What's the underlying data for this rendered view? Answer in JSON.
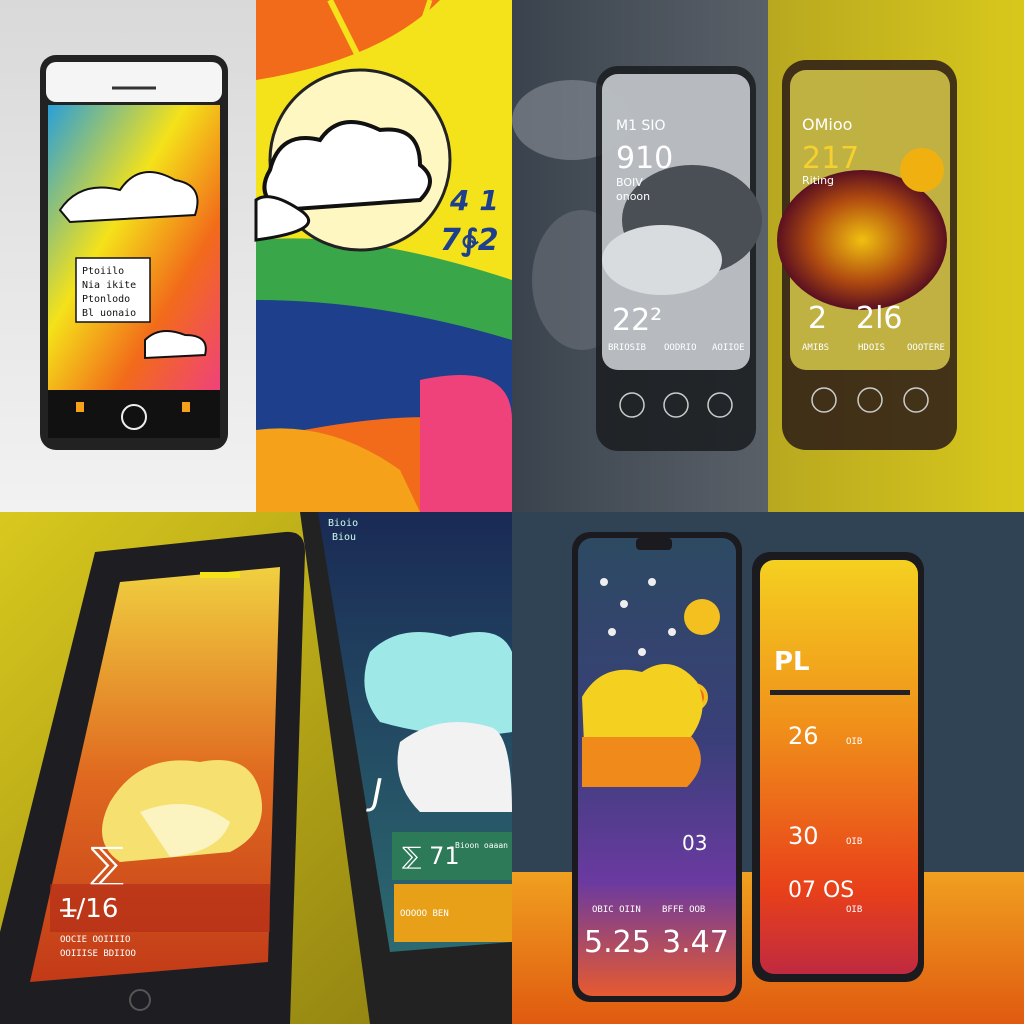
{
  "panels": [
    {
      "style": "pop-art illustrated weather phone with sun rays and clouds",
      "phone_text": [
        "Ptoiilo",
        "Nia ikite",
        "Ptonlodo",
        "Bl uonaio"
      ],
      "side_numbers": [
        "4 1",
        "7∲2"
      ],
      "colors": {
        "yellow": "#f4e21a",
        "orange": "#f26b1a",
        "pink": "#f0427a",
        "blue": "#1e3f8c",
        "green": "#3aa64a"
      }
    },
    {
      "style": "frosted glass phones with dark storm cloud and yellow smoke",
      "left_phone": {
        "header": "M1 SIO",
        "temp": "910",
        "sub1": "BOIV",
        "sub2": "onoon",
        "big": "22²",
        "labels": [
          "BRIOSIB",
          "OODRIO",
          "AOIIOE"
        ]
      },
      "right_phone": {
        "header": "OMioo",
        "temp": "217",
        "sub1": "Riting",
        "big_left": "2",
        "big_right": "2l6",
        "labels": [
          "AMIBS",
          "HDOIS",
          "OOOTERE"
        ]
      },
      "colors": {
        "bg_left": "#3f4852",
        "bg_right": "#d1c11d"
      }
    },
    {
      "style": "angled phones with yellow smoky cloud and teal cloud",
      "left_phone": {
        "big_glyph": "⅀",
        "temp": "1̶/16",
        "row1": "OOCIE  OOIIIIO",
        "row2": "OOIIISE  BDIIOO"
      },
      "right_phone": {
        "top1": "Bioio",
        "top2": "Biou",
        "big_glyph": "J",
        "temp": "⅀ 71",
        "label": "Bioon oaaan",
        "row": "OOOOO BEN"
      },
      "colors": {
        "bg": "#cdbc1e"
      }
    },
    {
      "style": "rain and sun phone beside orange forecast phone",
      "left_phone": {
        "small": "03",
        "labels": [
          "OBIC OIIN",
          "BFFE OOB"
        ],
        "temp_left": "5.25",
        "temp_right": "3.47"
      },
      "right_phone": {
        "header": "PL",
        "rows": [
          "26",
          "30",
          "07 OS"
        ],
        "sub_labels": [
          "OIB",
          "OIB",
          "OIB"
        ]
      },
      "colors": {
        "bg_top": "#2f4354",
        "floor": "#e67e16"
      }
    }
  ]
}
